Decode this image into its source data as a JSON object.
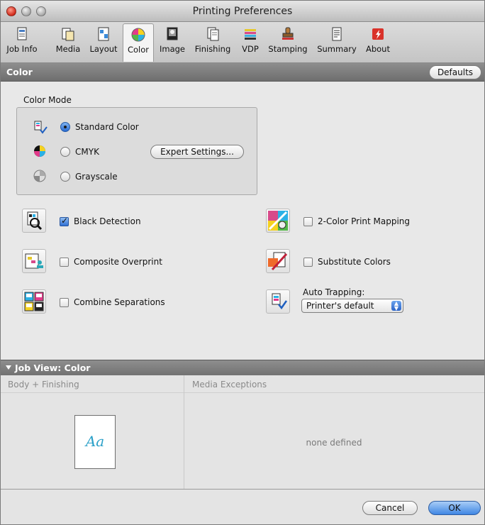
{
  "window": {
    "title": "Printing Preferences"
  },
  "toolbar": {
    "items": [
      {
        "label": "Job Info",
        "icon": "job-info-icon"
      },
      {
        "label": "Media",
        "icon": "media-icon"
      },
      {
        "label": "Layout",
        "icon": "layout-icon"
      },
      {
        "label": "Color",
        "icon": "color-icon",
        "selected": true
      },
      {
        "label": "Image",
        "icon": "image-icon"
      },
      {
        "label": "Finishing",
        "icon": "finishing-icon"
      },
      {
        "label": "VDP",
        "icon": "vdp-icon"
      },
      {
        "label": "Stamping",
        "icon": "stamping-icon"
      },
      {
        "label": "Summary",
        "icon": "summary-icon"
      },
      {
        "label": "About",
        "icon": "about-icon"
      }
    ]
  },
  "section": {
    "title": "Color",
    "defaults_label": "Defaults"
  },
  "color_mode": {
    "label": "Color Mode",
    "options": [
      {
        "label": "Standard Color",
        "selected": true,
        "icon": "standard-color-icon"
      },
      {
        "label": "CMYK",
        "selected": false,
        "icon": "cmyk-icon"
      },
      {
        "label": "Grayscale",
        "selected": false,
        "icon": "grayscale-icon"
      }
    ],
    "expert_settings_label": "Expert Settings..."
  },
  "options": {
    "black_detection": {
      "label": "Black Detection",
      "checked": true,
      "icon": "black-detection-icon"
    },
    "composite_overprint": {
      "label": "Composite Overprint",
      "checked": false,
      "icon": "composite-overprint-icon"
    },
    "combine_separations": {
      "label": "Combine Separations",
      "checked": false,
      "icon": "combine-separations-icon"
    },
    "two_color_print_mapping": {
      "label": "2-Color Print Mapping",
      "checked": false,
      "icon": "two-color-mapping-icon"
    },
    "substitute_colors": {
      "label": "Substitute Colors",
      "checked": false,
      "icon": "substitute-colors-icon"
    },
    "auto_trapping": {
      "label": "Auto Trapping:",
      "value": "Printer's default",
      "icon": "auto-trapping-icon"
    }
  },
  "job_view": {
    "title": "Job View: Color",
    "col_body": "Body + Finishing",
    "col_media": "Media Exceptions",
    "preview_text": "Aa",
    "none_defined": "none defined"
  },
  "footer": {
    "cancel_label": "Cancel",
    "ok_label": "OK"
  },
  "colors": {
    "accent": "#3f86e3",
    "section_bar": "#7e7e7e",
    "preview_text": "#2aa0c8"
  }
}
